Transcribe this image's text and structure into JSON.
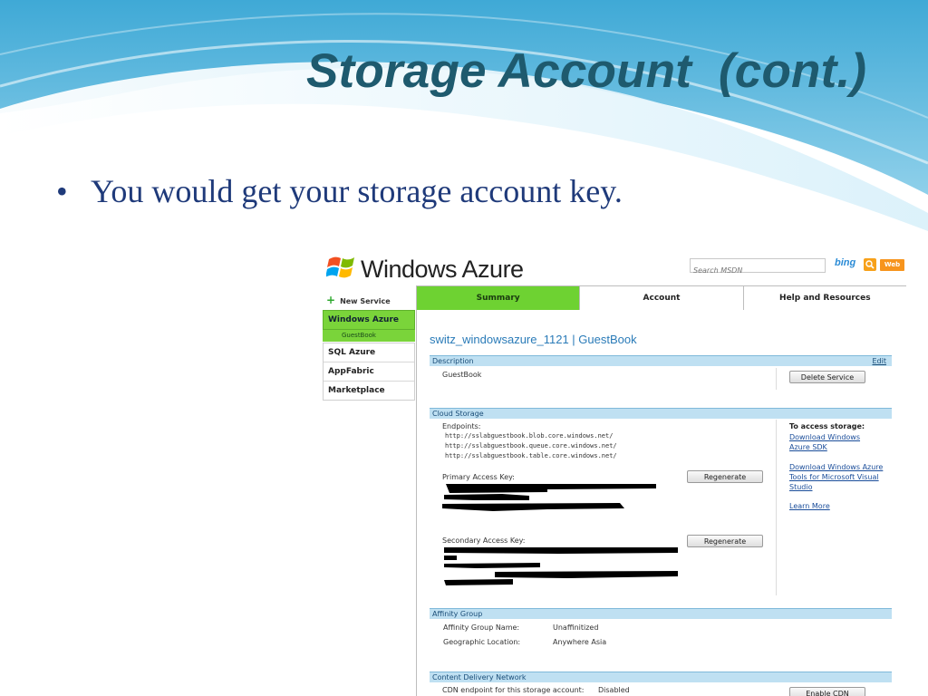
{
  "slide": {
    "title": "Storage Account  (cont.)",
    "bullet_symbol": "•",
    "bullet_text": "You would get your storage account key."
  },
  "portal": {
    "logo_text": "Windows Azure",
    "search_placeholder": "Search MSDN",
    "bing_label": "bing",
    "web_label": "Web",
    "new_service": "New Service",
    "tabs": [
      "Summary",
      "Account",
      "Help and Resources"
    ],
    "sidebar": {
      "group": "Windows Azure",
      "sub": "GuestBook",
      "items": [
        "SQL Azure",
        "AppFabric",
        "Marketplace"
      ]
    },
    "service_title": "switz_windowsazure_1121 | GuestBook",
    "description": {
      "header": "Description",
      "edit": "Edit",
      "value": "GuestBook",
      "delete_button": "Delete Service"
    },
    "cloud_storage": {
      "header": "Cloud Storage",
      "endpoints_label": "Endpoints:",
      "endpoints": [
        "http://sslabguestbook.blob.core.windows.net/",
        "http://sslabguestbook.queue.core.windows.net/",
        "http://sslabguestbook.table.core.windows.net/"
      ],
      "primary_label": "Primary Access Key:",
      "secondary_label": "Secondary Access Key:",
      "regenerate": "Regenerate",
      "access_title": "To access storage:",
      "links": [
        "Download Windows Azure SDK",
        "Download Windows Azure Tools for Microsoft Visual Studio",
        "Learn More"
      ]
    },
    "affinity": {
      "header": "Affinity Group",
      "name_label": "Affinity Group Name:",
      "name_value": "Unaffinitized",
      "location_label": "Geographic Location:",
      "location_value": "Anywhere Asia"
    },
    "cdn": {
      "header": "Content Delivery Network",
      "label": "CDN endpoint for this storage account:",
      "value": "Disabled",
      "button": "Enable CDN"
    }
  },
  "colors": {
    "title": "#1e5a6e",
    "bullet": "#1f3a7a",
    "active_tab": "#6ed232",
    "section_header": "#bfe0f2",
    "link": "#1a4d9a"
  }
}
